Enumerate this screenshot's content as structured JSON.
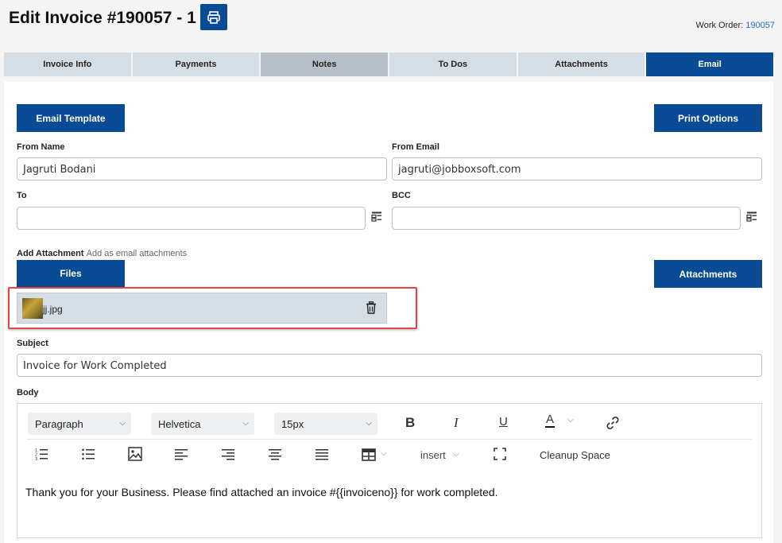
{
  "header": {
    "title": "Edit Invoice #190057 - 1",
    "work_order_label": "Work Order:",
    "work_order_value": "190057"
  },
  "tabs": [
    {
      "label": "Invoice Info"
    },
    {
      "label": "Payments"
    },
    {
      "label": "Notes"
    },
    {
      "label": "To Dos"
    },
    {
      "label": "Attachments"
    },
    {
      "label": "Email"
    }
  ],
  "active_tab": "Email",
  "buttons": {
    "email_template": "Email Template",
    "print_options": "Print Options",
    "files": "Files",
    "attachments": "Attachments"
  },
  "form": {
    "from_name_label": "From Name",
    "from_name_value": "Jagruti Bodani",
    "from_email_label": "From Email",
    "from_email_value": "jagruti@jobboxsoft.com",
    "to_label": "To",
    "to_value": "",
    "bcc_label": "BCC",
    "bcc_value": "",
    "add_attachment_label": "Add Attachment",
    "add_attachment_hint": "Add as email attachments",
    "subject_label": "Subject",
    "subject_value": "Invoice for Work Completed",
    "body_label": "Body"
  },
  "attachment": {
    "file_name": "jj.jpg"
  },
  "editor": {
    "paragraph_select": "Paragraph",
    "font_select": "Helvetica",
    "size_select": "15px",
    "insert_menu": "insert",
    "cleanup_label": "Cleanup Space",
    "body_text": "Thank you for your Business. Please find attached an invoice #{{invoiceno}} for work completed."
  },
  "colors": {
    "brand": "#0a4b96",
    "tab_bg": "#d5dde5",
    "highlight": "#e0454b",
    "link": "#1a6fd6"
  }
}
